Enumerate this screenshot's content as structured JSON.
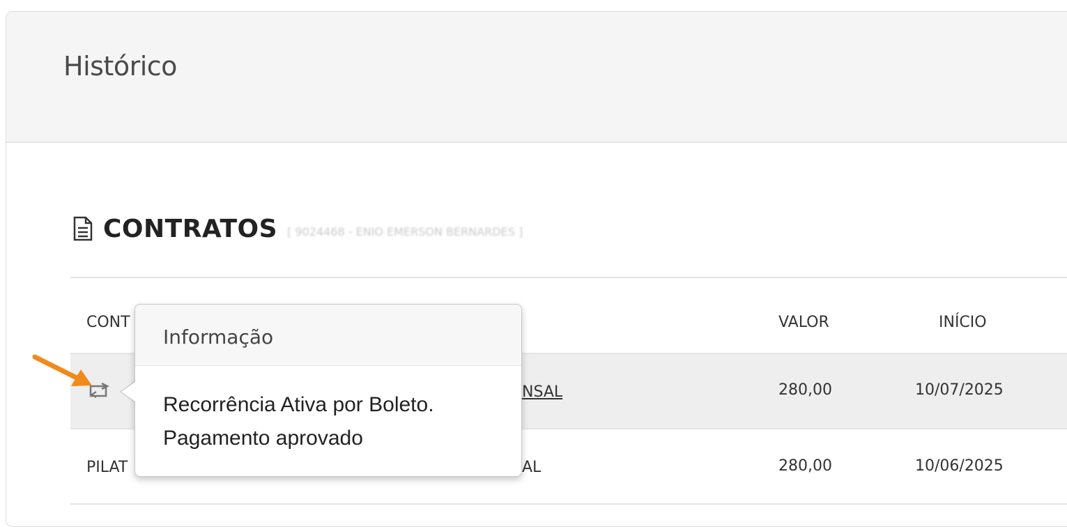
{
  "panel": {
    "title": "Histórico"
  },
  "section": {
    "title": "CONTRATOS",
    "subtitle": "[ 9024468 - ENIO EMERSON BERNARDES ]",
    "icon": "document-icon"
  },
  "table": {
    "headers": {
      "contract": "CONT",
      "value": "VALOR",
      "start": "INÍCIO"
    },
    "rows": [
      {
        "contract_visible_end": "NSAL",
        "value": "280,00",
        "start": "10/07/2025",
        "icon": "recurrence-icon",
        "highlighted": true
      },
      {
        "contract_visible_start": "PILAT",
        "contract_visible_end": "AL",
        "value": "280,00",
        "start": "10/06/2025",
        "highlighted": false
      }
    ]
  },
  "tooltip": {
    "title": "Informação",
    "line1": "Recorrência Ativa por Boleto.",
    "line2": "Pagamento aprovado"
  },
  "colors": {
    "arrow": "#f08a1c",
    "row_highlight": "#eeeeee",
    "header_bg": "#f5f5f5"
  }
}
